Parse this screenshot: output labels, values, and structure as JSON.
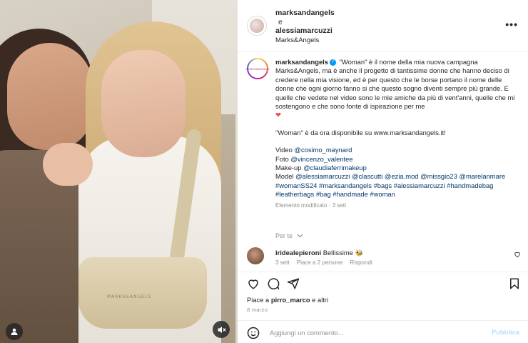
{
  "header": {
    "user1": "marksandangels",
    "conj": "e",
    "user2": "alessiamarcuzzi",
    "subtitle": "Marks&Angels",
    "more_icon": "more-horizontal-icon"
  },
  "media": {
    "bag_logo": "MARKS&ANGELS",
    "user_icon": "user-tag-icon",
    "mute_icon": "muted-speaker-icon"
  },
  "caption": {
    "username": "marksandangels",
    "avatar_text": "MARKS&ANGELS",
    "line1": " \"Woman\" è il nome della mia nuova campagna Marks&Angels, ma è anche il progetto di tantissime donne che hanno deciso di credere nella mia visione, ed è per questo che le borse portano il nome delle donne che ogni giorno fanno si che questo sogno diventi sempre più grande. E quelle che vedete nel video sono le mie amiche da più di vent'anni, quelle che mi sostengono e che sono fonte di ispirazione per me",
    "heart": "❤",
    "line2_prefix": "\"Woman\" è da ora disponibile su ",
    "line2_link": "www.marksandangels.it",
    "line2_suffix": "!",
    "video_label": "Video ",
    "video_handle": "@cosimo_maynard",
    "foto_label": "Foto ",
    "foto_handle": "@vincenzo_valentee",
    "makeup_label": "Make-up ",
    "makeup_handle": "@claudiaferrimakeup",
    "model_label": "Model ",
    "model_handles": "@alessiamarcuzzi @clascutti @ezia.mod @missgio23 @marelanmare",
    "hashtags": "#womanSS24 #marksandangels #bags #alessiamarcuzzi #handmadebag #leatherbags #bag #handmade #woman",
    "meta": "Elemento modificato · 3 sett"
  },
  "for_you": "Per te",
  "comment": {
    "username": "iridealepieroni",
    "text": " Bellissime 🐝",
    "time": "3 sett",
    "likes": "Piace a 2 persone",
    "reply": "Rispondi"
  },
  "likes": {
    "prefix": "Piace a ",
    "user": "pirro_marco",
    "suffix": " e altri"
  },
  "date": "8 marzo",
  "add_comment": {
    "placeholder": "Aggiungi un commento...",
    "publish": "Pubblica"
  },
  "colors": {
    "accent": "#0095f6",
    "publish_disabled": "#b2dffc",
    "text": "#262626",
    "muted": "#8e8e8e",
    "link": "#00376b",
    "heart": "#ed4956"
  }
}
